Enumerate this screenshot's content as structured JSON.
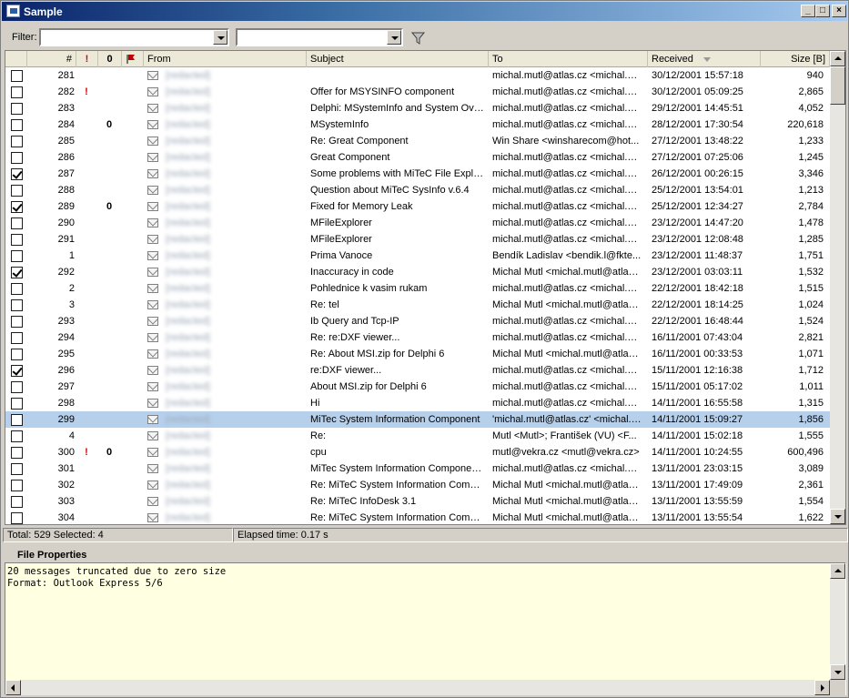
{
  "window": {
    "title": "Sample"
  },
  "filter": {
    "label": "Filter:",
    "combo1_value": "",
    "combo2_value": ""
  },
  "columns": {
    "num": "#",
    "importance": "!",
    "attachment": "0",
    "flag": "flag",
    "from": "From",
    "subject": "Subject",
    "to": "To",
    "received": "Received",
    "size": "Size [B]"
  },
  "messages": [
    {
      "checked": false,
      "num": "281",
      "imp": "",
      "att": "",
      "from": "[redacted]",
      "subject": "",
      "to": "michal.mutl@atlas.cz <michal.m...",
      "received": "30/12/2001 15:57:18",
      "size": "940",
      "selected": false
    },
    {
      "checked": false,
      "num": "282",
      "imp": "!",
      "att": "",
      "from": "[redacted]",
      "subject": "Offer for MSYSINFO component",
      "to": "michal.mutl@atlas.cz <michal.m...",
      "received": "30/12/2001 05:09:25",
      "size": "2,865",
      "selected": false
    },
    {
      "checked": false,
      "num": "283",
      "imp": "",
      "att": "",
      "from": "[redacted]",
      "subject": "Delphi: MSystemInfo and System Ove...",
      "to": "michal.mutl@atlas.cz <michal.m...",
      "received": "29/12/2001 14:45:51",
      "size": "4,052",
      "selected": false
    },
    {
      "checked": false,
      "num": "284",
      "imp": "",
      "att": "0",
      "from": "[redacted]",
      "subject": "MSystemInfo",
      "to": "michal.mutl@atlas.cz <michal.m...",
      "received": "28/12/2001 17:30:54",
      "size": "220,618",
      "selected": false
    },
    {
      "checked": false,
      "num": "285",
      "imp": "",
      "att": "",
      "from": "[redacted]",
      "subject": "Re: Great Component",
      "to": "Win Share <winsharecom@hot...",
      "received": "27/12/2001 13:48:22",
      "size": "1,233",
      "selected": false
    },
    {
      "checked": false,
      "num": "286",
      "imp": "",
      "att": "",
      "from": "[redacted]",
      "subject": "Great Component",
      "to": "michal.mutl@atlas.cz <michal.m...",
      "received": "27/12/2001 07:25:06",
      "size": "1,245",
      "selected": false
    },
    {
      "checked": true,
      "num": "287",
      "imp": "",
      "att": "",
      "from": "[redacted]",
      "subject": "Some problems with MiTeC File Explor...",
      "to": "michal.mutl@atlas.cz <michal.m...",
      "received": "26/12/2001 00:26:15",
      "size": "3,346",
      "selected": false
    },
    {
      "checked": false,
      "num": "288",
      "imp": "",
      "att": "",
      "from": "[redacted]",
      "subject": "Question about MiTeC SysInfo v.6.4",
      "to": "michal.mutl@atlas.cz <michal.m...",
      "received": "25/12/2001 13:54:01",
      "size": "1,213",
      "selected": false
    },
    {
      "checked": true,
      "num": "289",
      "imp": "",
      "att": "0",
      "from": "[redacted]",
      "subject": "Fixed for Memory Leak",
      "to": "michal.mutl@atlas.cz <michal.m...",
      "received": "25/12/2001 12:34:27",
      "size": "2,784",
      "selected": false
    },
    {
      "checked": false,
      "num": "290",
      "imp": "",
      "att": "",
      "from": "[redacted]",
      "subject": "MFileExplorer",
      "to": "michal.mutl@atlas.cz <michal.m...",
      "received": "23/12/2001 14:47:20",
      "size": "1,478",
      "selected": false
    },
    {
      "checked": false,
      "num": "291",
      "imp": "",
      "att": "",
      "from": "[redacted]",
      "subject": "MFileExplorer",
      "to": "michal.mutl@atlas.cz <michal.m...",
      "received": "23/12/2001 12:08:48",
      "size": "1,285",
      "selected": false
    },
    {
      "checked": false,
      "num": "1",
      "imp": "",
      "att": "",
      "from": "[redacted]",
      "subject": "Prima Vanoce",
      "to": "Bendík Ladislav <bendik.l@fkte...",
      "received": "23/12/2001 11:48:37",
      "size": "1,751",
      "selected": false
    },
    {
      "checked": true,
      "num": "292",
      "imp": "",
      "att": "",
      "from": "[redacted]",
      "subject": "Inaccuracy in code",
      "to": "Michal Mutl <michal.mutl@atlas....",
      "received": "23/12/2001 03:03:11",
      "size": "1,532",
      "selected": false
    },
    {
      "checked": false,
      "num": "2",
      "imp": "",
      "att": "",
      "from": "[redacted]",
      "subject": "Pohlednice k vasim rukam",
      "to": "michal.mutl@atlas.cz <michal.m...",
      "received": "22/12/2001 18:42:18",
      "size": "1,515",
      "selected": false
    },
    {
      "checked": false,
      "num": "3",
      "imp": "",
      "att": "",
      "from": "[redacted]",
      "subject": "Re: tel",
      "to": "Michal Mutl <michal.mutl@atlas....",
      "received": "22/12/2001 18:14:25",
      "size": "1,024",
      "selected": false
    },
    {
      "checked": false,
      "num": "293",
      "imp": "",
      "att": "",
      "from": "[redacted]",
      "subject": "Ib Query and Tcp-IP",
      "to": "michal.mutl@atlas.cz <michal.m...",
      "received": "22/12/2001 16:48:44",
      "size": "1,524",
      "selected": false
    },
    {
      "checked": false,
      "num": "294",
      "imp": "",
      "att": "",
      "from": "[redacted]",
      "subject": "Re: re:DXF viewer...",
      "to": "michal.mutl@atlas.cz <michal.m...",
      "received": "16/11/2001 07:43:04",
      "size": "2,821",
      "selected": false
    },
    {
      "checked": false,
      "num": "295",
      "imp": "",
      "att": "",
      "from": "[redacted]",
      "subject": "Re: About MSI.zip for Delphi 6",
      "to": "Michal Mutl <michal.mutl@atlas....",
      "received": "16/11/2001 00:33:53",
      "size": "1,071",
      "selected": false
    },
    {
      "checked": true,
      "num": "296",
      "imp": "",
      "att": "",
      "from": "[redacted]",
      "subject": "re:DXF viewer...",
      "to": "michal.mutl@atlas.cz <michal.m...",
      "received": "15/11/2001 12:16:38",
      "size": "1,712",
      "selected": false
    },
    {
      "checked": false,
      "num": "297",
      "imp": "",
      "att": "",
      "from": "[redacted]",
      "subject": "About MSI.zip for Delphi 6",
      "to": "michal.mutl@atlas.cz <michal.m...",
      "received": "15/11/2001 05:17:02",
      "size": "1,011",
      "selected": false
    },
    {
      "checked": false,
      "num": "298",
      "imp": "",
      "att": "",
      "from": "[redacted]",
      "subject": "Hi",
      "to": "michal.mutl@atlas.cz <michal.m...",
      "received": "14/11/2001 16:55:58",
      "size": "1,315",
      "selected": false
    },
    {
      "checked": false,
      "num": "299",
      "imp": "",
      "att": "",
      "from": "[redacted]",
      "subject": "MiTec System Information Component",
      "to": "'michal.mutl@atlas.cz' <michal.m...",
      "received": "14/11/2001 15:09:27",
      "size": "1,856",
      "selected": true
    },
    {
      "checked": false,
      "num": "4",
      "imp": "",
      "att": "",
      "from": "[redacted]",
      "subject": "Re:",
      "to": "Mutl <Mutl>; František (VU)  <F...",
      "received": "14/11/2001 15:02:18",
      "size": "1,555",
      "selected": false
    },
    {
      "checked": false,
      "num": "300",
      "imp": "!",
      "att": "0",
      "from": "[redacted]",
      "subject": "cpu",
      "to": "mutl@vekra.cz <mutl@vekra.cz>",
      "received": "14/11/2001 10:24:55",
      "size": "600,496",
      "selected": false
    },
    {
      "checked": false,
      "num": "301",
      "imp": "",
      "att": "",
      "from": "[redacted]",
      "subject": "MiTec  System Information Componen...",
      "to": "michal.mutl@atlas.cz <michal.m...",
      "received": "13/11/2001 23:03:15",
      "size": "3,089",
      "selected": false
    },
    {
      "checked": false,
      "num": "302",
      "imp": "",
      "att": "",
      "from": "[redacted]",
      "subject": "Re: MiTeC System Information Compo...",
      "to": "Michal Mutl <michal.mutl@atlas....",
      "received": "13/11/2001 17:49:09",
      "size": "2,361",
      "selected": false
    },
    {
      "checked": false,
      "num": "303",
      "imp": "",
      "att": "",
      "from": "[redacted]",
      "subject": "Re: MiTeC InfoDesk 3.1",
      "to": "Michal Mutl <michal.mutl@atlas....",
      "received": "13/11/2001 13:55:59",
      "size": "1,554",
      "selected": false
    },
    {
      "checked": false,
      "num": "304",
      "imp": "",
      "att": "",
      "from": "[redacted]",
      "subject": "Re: MiTeC System Information Compo...",
      "to": "Michal Mutl <michal.mutl@atlas....",
      "received": "13/11/2001 13:55:54",
      "size": "1,622",
      "selected": false
    }
  ],
  "status": {
    "total_selected": "Total: 529   Selected: 4",
    "elapsed": "Elapsed time: 0.17 s"
  },
  "properties": {
    "title": "File Properties",
    "text": "20 messages truncated due to zero size\nFormat: Outlook Express 5/6"
  },
  "colors": {
    "selected_row": "#b6d0ec",
    "importance": "#e00000",
    "props_background": "#ffffe1",
    "titlebar": "#0a246a"
  },
  "icons": [
    "app-icon",
    "minimize-icon",
    "maximize-icon",
    "close-icon",
    "funnel-icon",
    "checkbox-icon",
    "envelope-icon",
    "flag-icon",
    "paperclip-icon",
    "sort-desc-icon"
  ]
}
